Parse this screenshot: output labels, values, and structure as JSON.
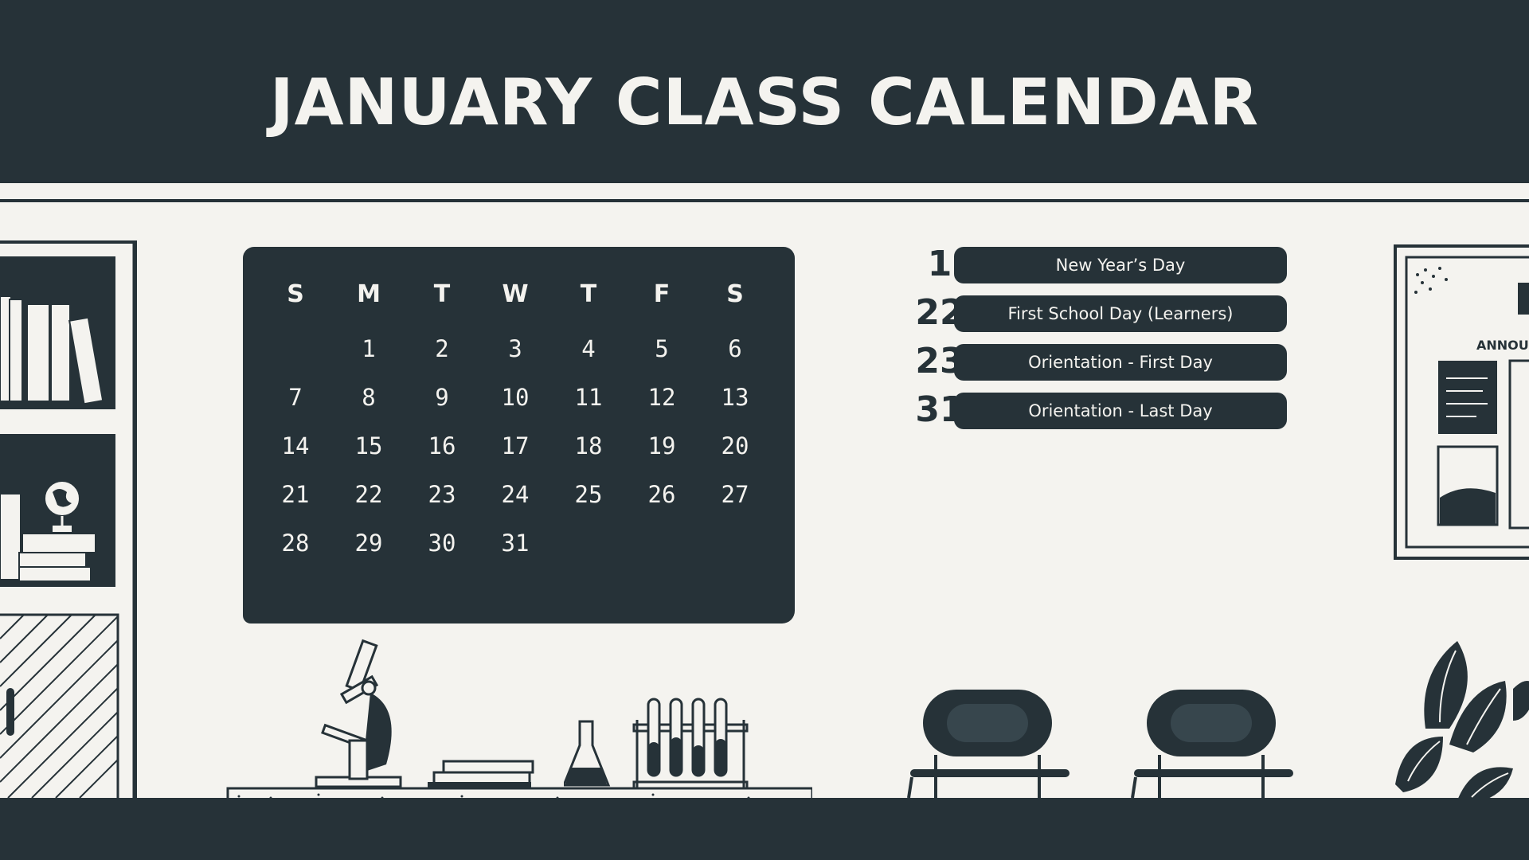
{
  "title": "JANUARY CLASS CALENDAR",
  "calendar": {
    "weekdays": [
      "S",
      "M",
      "T",
      "W",
      "T",
      "F",
      "S"
    ],
    "days": [
      "",
      "1",
      "2",
      "3",
      "4",
      "5",
      "6",
      "7",
      "8",
      "9",
      "10",
      "11",
      "12",
      "13",
      "14",
      "15",
      "16",
      "17",
      "18",
      "19",
      "20",
      "21",
      "22",
      "23",
      "24",
      "25",
      "26",
      "27",
      "28",
      "29",
      "30",
      "31",
      "",
      "",
      ""
    ]
  },
  "events": [
    {
      "day": "1",
      "label": "New Year’s Day"
    },
    {
      "day": "22",
      "label": "First School Day (Learners)"
    },
    {
      "day": "23",
      "label": "Orientation - First Day"
    },
    {
      "day": "31",
      "label": "Orientation - Last Day"
    }
  ],
  "board": {
    "label": "ANNOUN"
  },
  "colors": {
    "dark": "#263238",
    "light": "#f4f3ef"
  },
  "icons": [
    "bookshelf-icon",
    "globe-icon",
    "microscope-icon",
    "flask-icon",
    "test-tubes-icon",
    "chair-icon",
    "plant-icon",
    "bulletin-board-icon"
  ]
}
